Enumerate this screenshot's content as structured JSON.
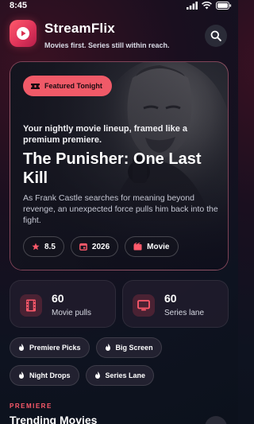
{
  "status_bar": {
    "time": "8:45",
    "icons": [
      "signal-icon",
      "wifi-icon",
      "battery-icon"
    ]
  },
  "header": {
    "app_name": "StreamFlix",
    "tagline": "Movies first. Series still within reach.",
    "logo_icon": "play-icon",
    "search_icon": "search-icon"
  },
  "hero": {
    "badge": "Featured Tonight",
    "kicker": "Your nightly movie lineup, framed like a premium premiere.",
    "title": "The Punisher: One Last Kill",
    "description": "As Frank Castle searches for meaning beyond revenge, an unexpected force pulls him back into the fight.",
    "chips": [
      {
        "icon": "star-icon",
        "label": "8.5"
      },
      {
        "icon": "calendar-icon",
        "label": "2026"
      },
      {
        "icon": "film-icon",
        "label": "Movie"
      }
    ]
  },
  "stats": [
    {
      "icon": "film-strip-icon",
      "value": "60",
      "label": "Movie pulls"
    },
    {
      "icon": "tv-icon",
      "value": "60",
      "label": "Series lane"
    }
  ],
  "tags": [
    {
      "icon": "flame-icon",
      "label": "Premiere Picks"
    },
    {
      "icon": "flame-icon",
      "label": "Big Screen"
    },
    {
      "icon": "flame-icon",
      "label": "Night Drops"
    },
    {
      "icon": "flame-icon",
      "label": "Series Lane"
    }
  ],
  "section": {
    "kicker": "PREMIERE",
    "title": "Trending Movies"
  },
  "colors": {
    "accent": "#f05a68",
    "background": "#0e1320",
    "card": "#231e2d"
  }
}
